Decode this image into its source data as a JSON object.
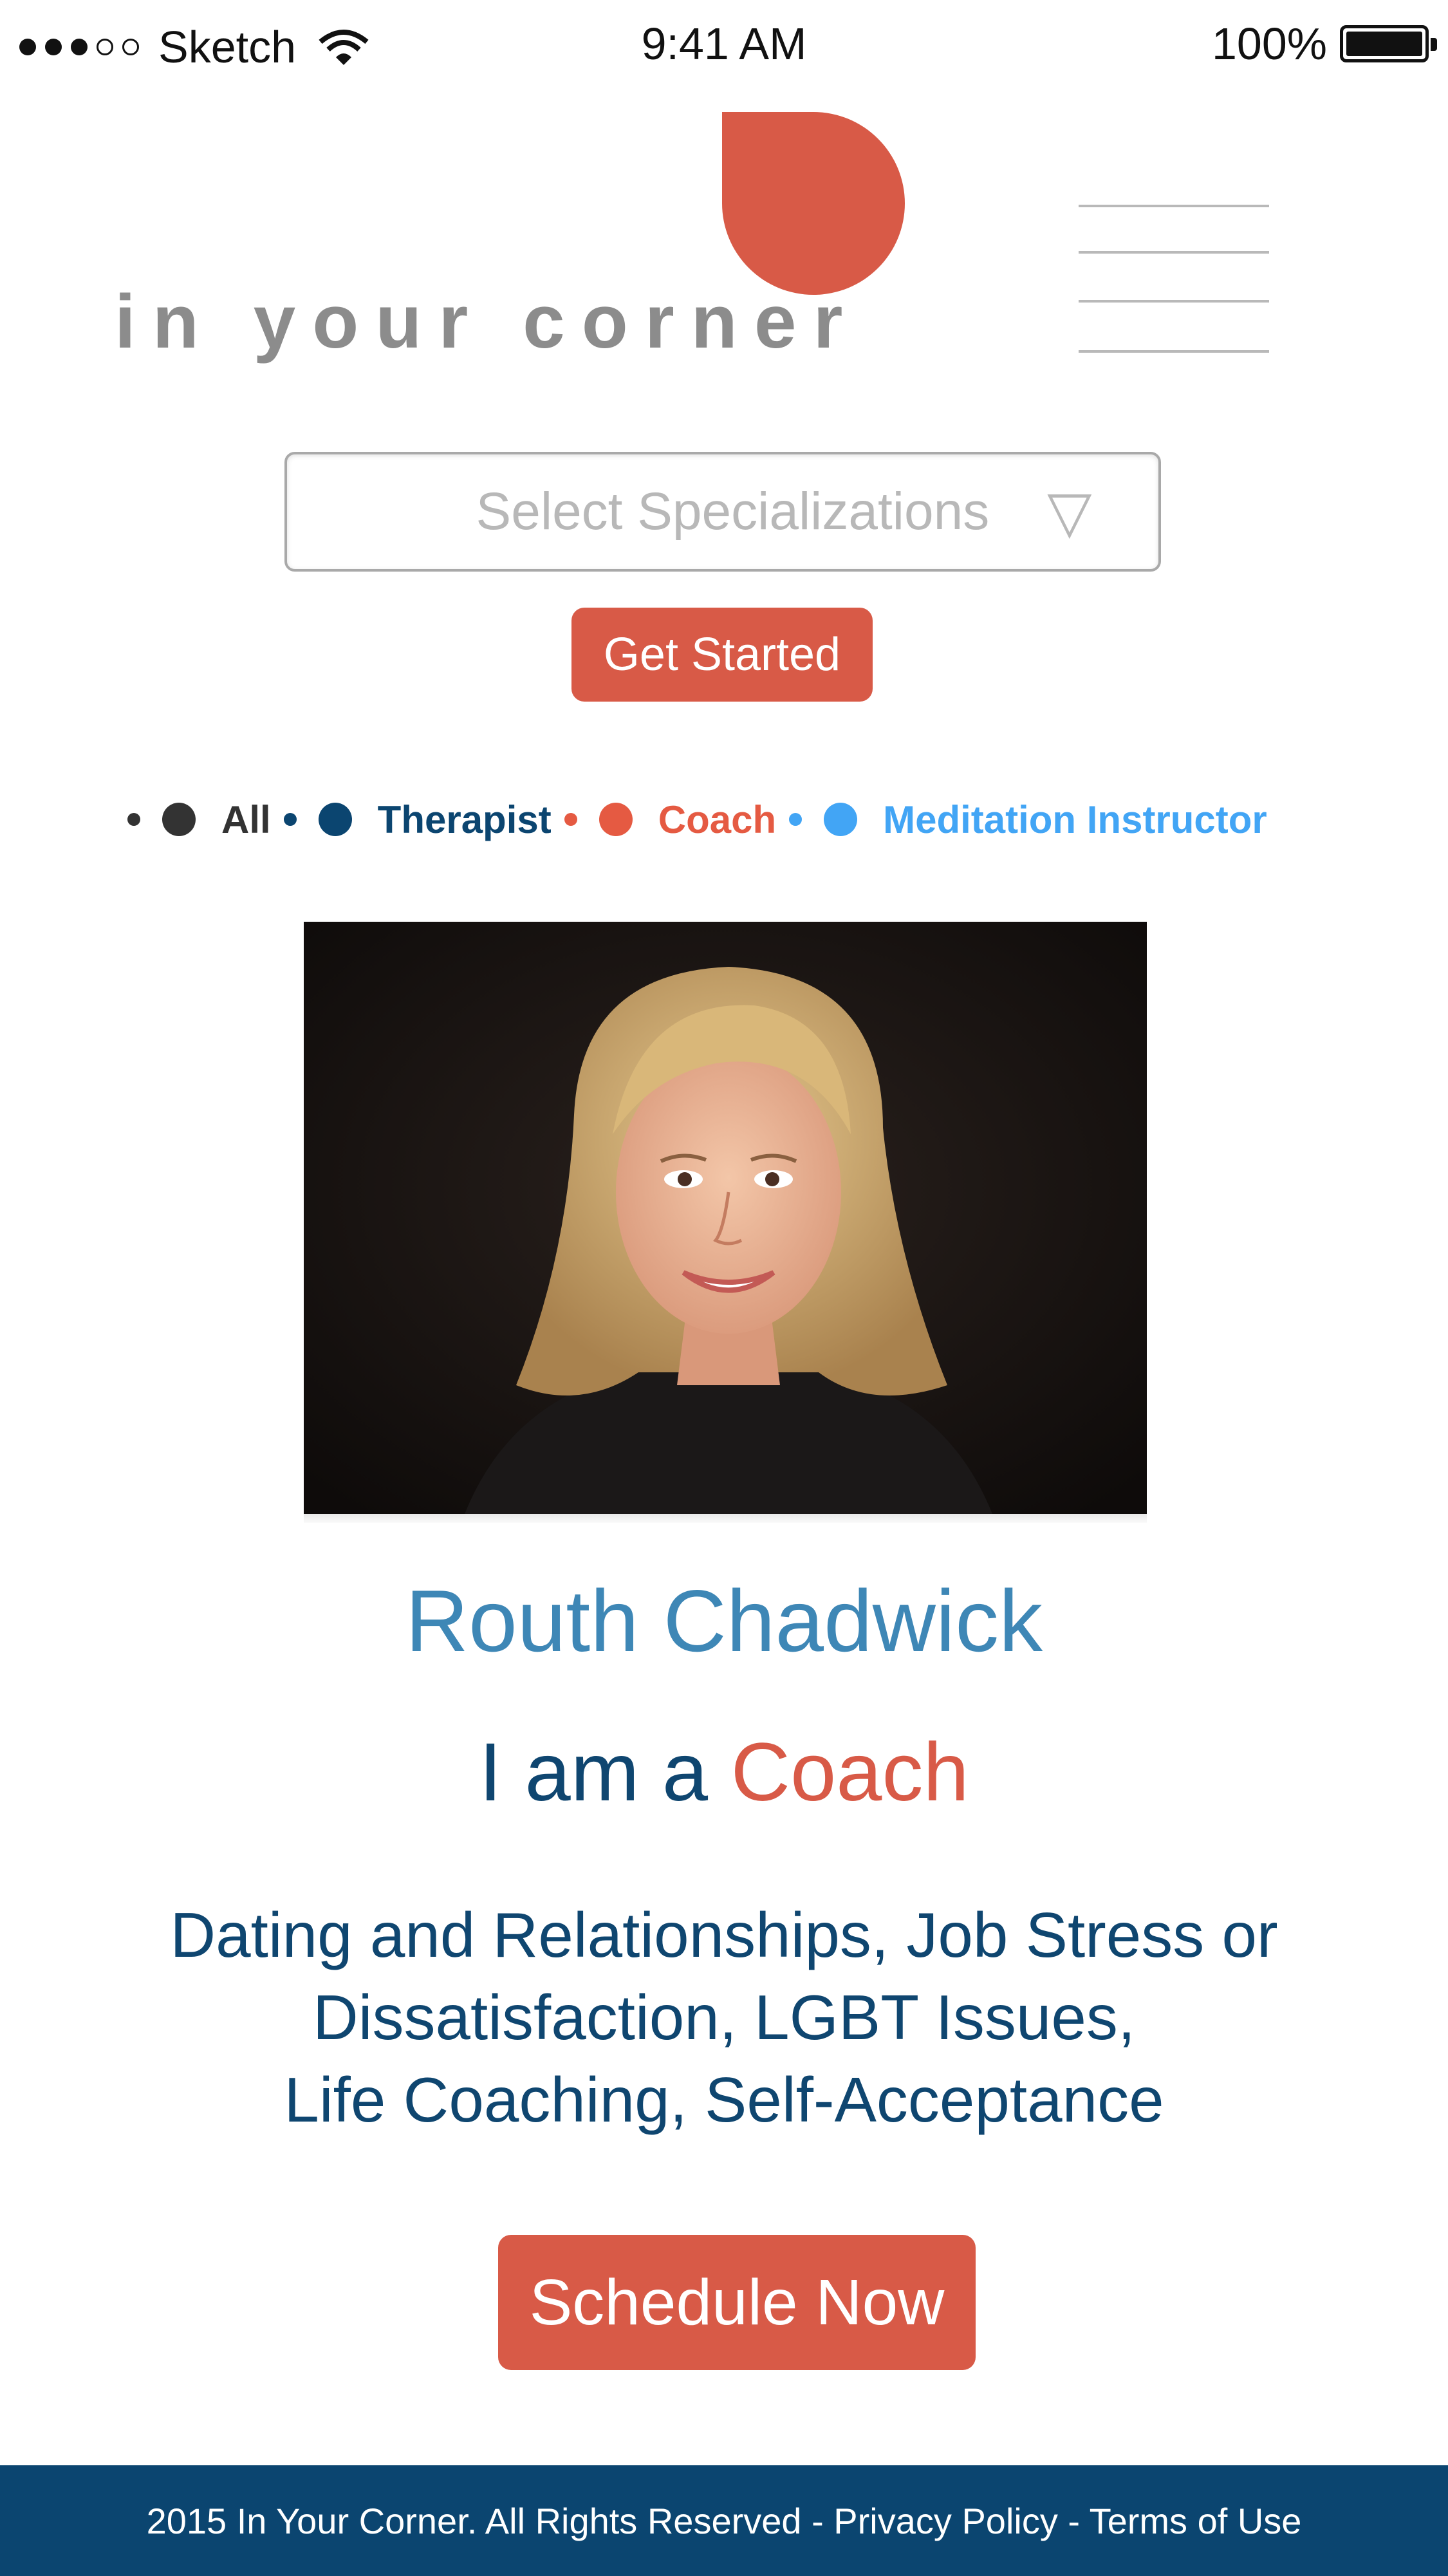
{
  "status_bar": {
    "carrier": "Sketch",
    "time": "9:41 AM",
    "battery": "100%",
    "signal_bars_filled": 3,
    "signal_bars_total": 5
  },
  "header": {
    "logo_text": "in your corner",
    "menu_icon": "hamburger-icon"
  },
  "search": {
    "select_placeholder": "Select Specializations",
    "select_caret": "▽",
    "get_started_label": "Get Started"
  },
  "filters": [
    {
      "label": "All",
      "color": "#333333"
    },
    {
      "label": "Therapist",
      "color": "#0b4570"
    },
    {
      "label": "Coach",
      "color": "#e55a42"
    },
    {
      "label": "Meditation Instructor",
      "color": "#42a5f5"
    }
  ],
  "profile": {
    "name": "Routh Chadwick",
    "role_prefix": "I am a",
    "role": "Coach",
    "specialties_line1": "Dating and Relationships, Job Stress or",
    "specialties_line2": "Dissatisfaction, LGBT Issues,",
    "specialties_line3": "Life Coaching, Self-Acceptance",
    "schedule_label": "Schedule Now"
  },
  "footer": {
    "text": "2015 In Your Corner. All Rights Reserved - Privacy Policy - Terms of Use"
  },
  "colors": {
    "brand": "#d85a47",
    "navy": "#0b4570",
    "name_blue": "#3e87b6"
  }
}
